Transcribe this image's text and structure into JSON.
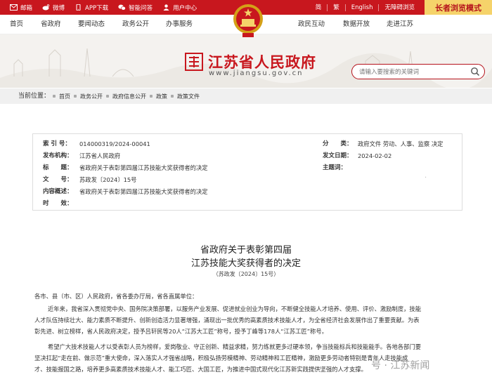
{
  "topbar": {
    "left_items": [
      {
        "icon": "mail-icon",
        "label": "邮箱"
      },
      {
        "icon": "weibo-icon",
        "label": "微博"
      },
      {
        "icon": "mobile-icon",
        "label": "APP下载"
      },
      {
        "icon": "wechat-icon",
        "label": "智能问答"
      },
      {
        "icon": "user-icon",
        "label": "用户中心"
      }
    ],
    "right_items": [
      "简",
      "繁",
      "English",
      "无障碍浏览"
    ],
    "elder_mode": "长者浏览模式",
    "color": "#c8171e"
  },
  "nav": {
    "left": [
      "首页",
      "省政府",
      "要闻动态",
      "政务公开",
      "办事服务"
    ],
    "right": [
      "政民互动",
      "数据开放",
      "走进江苏"
    ]
  },
  "brand": {
    "name_cn": "江苏省人民政府",
    "name_en": "www.jiangsu.gov.cn"
  },
  "search": {
    "placeholder": "请输入要搜索的关键词"
  },
  "breadcrumb": {
    "label": "当前位置：",
    "items": [
      "首页",
      "政务公开",
      "政府信息公开",
      "政策",
      "政策文件"
    ]
  },
  "info": {
    "index_label": "索 引 号：",
    "index_value": "014000319/2024-00041",
    "category_label": "分　　类：",
    "category_value": "政府文件 劳动、人事、监察 决定",
    "publisher_label": "发布机构：",
    "publisher_value": "江苏省人民政府",
    "date_label": "发文日期：",
    "date_value": "2024-02-02",
    "title_label": "标　　题：",
    "title_value": "省政府关于表彰第四届江苏技能大奖获得者的决定",
    "topic_label": "主题词：",
    "topic_value": "",
    "docno_label": "文　　号：",
    "docno_value": "苏政发〔2024〕15号",
    "summary_label": "内容概述：",
    "summary_value": "省政府关于表彰第四届江苏技能大奖获得者的决定",
    "validity_label": "时　　效：",
    "validity_value": ""
  },
  "article": {
    "title_line1": "省政府关于表彰第四届",
    "title_line2": "江苏技能大奖获得者的决定",
    "docno": "（苏政发〔2024〕15号）",
    "salutation": "各市、县（市、区）人民政府，省各委办厅局，省各直属单位：",
    "p1_l1": "近年来，我省深入贯彻党中央、国务院决策部署，以服务产业发展、促进就业创业为导向，不断健全技能人才培养、使用、评价、激励制度，技能",
    "p1_l2": "人才队伍持续壮大、能力素质不断提升、创新创造活力显著增强，涌现出一批优秀的高素质技术技能人才，为全省经济社会发展作出了重要贡献。为表",
    "p1_l3": "彰先进、树立榜样，省人民政府决定，授予吕轩民等20人“江苏大工匠”称号，授予丁峰等178人“江苏工匠”称号。",
    "p2_l1": "希望广大技术技能人才以受表彰人员为榜样，爱岗敬业、守正创新、精益求精，努力练就更多过硬本领，争当技能标兵和技能能手。各地各部门要",
    "p2_l2": "坚决扛起“走在前、做示范”重大使命，深入落实人才强省战略，积极弘扬劳模精神、劳动精神和工匠精神，激励更多劳动者特别是青年人走技能成",
    "p2_l3": "才、技能报国之路，培养更多高素质技术技能人才、能工巧匠、大国工匠，为推进中国式现代化江苏新实践提供坚强的人才支撑。"
  },
  "watermark": {
    "text": "号 · 江苏新闻"
  }
}
